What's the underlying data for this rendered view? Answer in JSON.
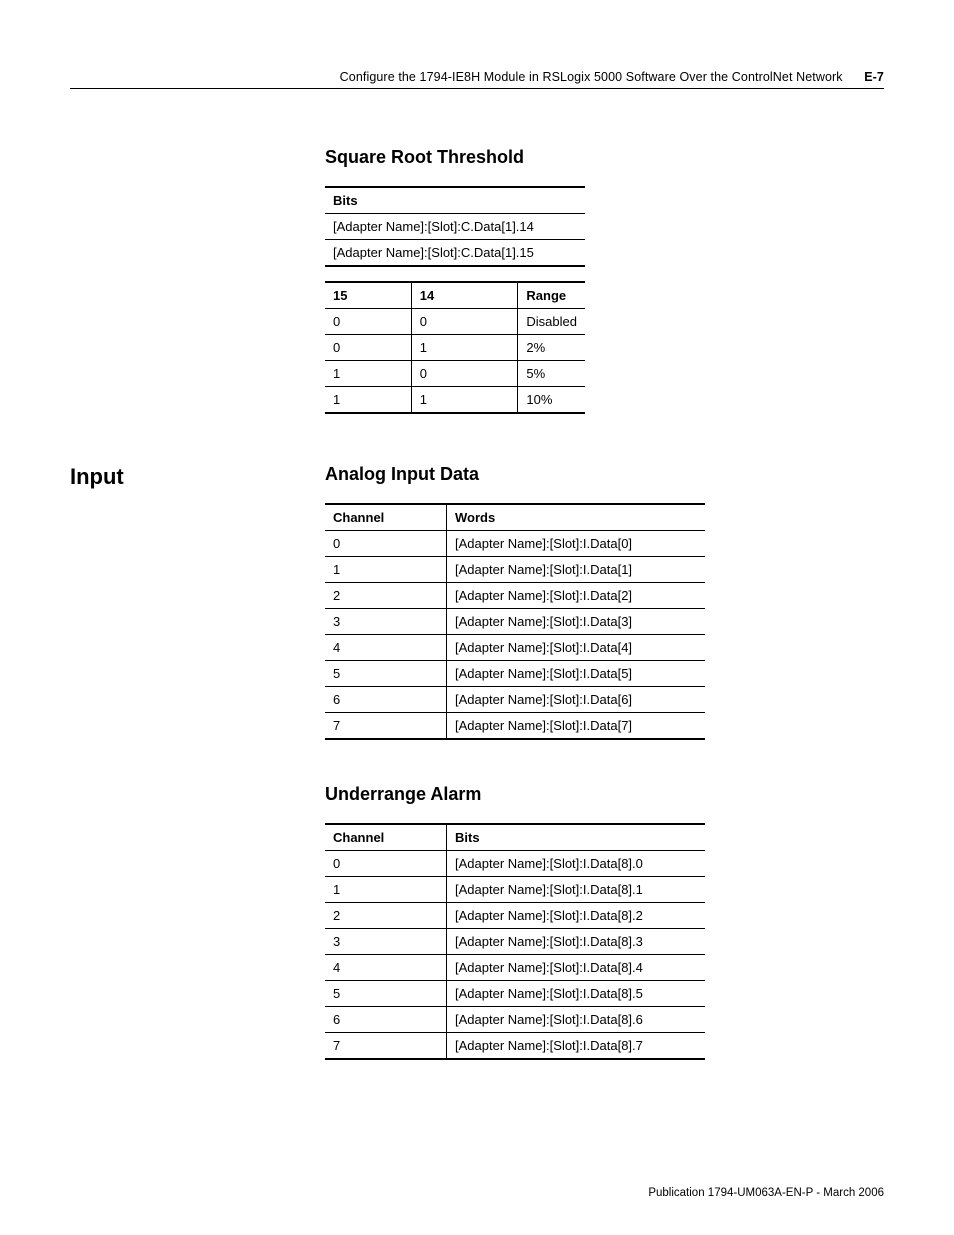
{
  "header": {
    "title": "Configure the 1794-IE8H Module in RSLogix 5000 Software Over the ControlNet Network",
    "page": "E-7"
  },
  "section1": {
    "heading": "Square Root Threshold",
    "bitsTable": {
      "header": "Bits",
      "rows": [
        "[Adapter Name]:[Slot]:C.Data[1].14",
        "[Adapter Name]:[Slot]:C.Data[1].15"
      ]
    },
    "rangeTable": {
      "headers": [
        "15",
        "14",
        "Range"
      ],
      "rows": [
        [
          "0",
          "0",
          "Disabled"
        ],
        [
          "0",
          "1",
          "2%"
        ],
        [
          "1",
          "0",
          "5%"
        ],
        [
          "1",
          "1",
          "10%"
        ]
      ]
    }
  },
  "section2": {
    "leftLabel": "Input",
    "heading": "Analog Input Data",
    "table": {
      "headers": [
        "Channel",
        "Words"
      ],
      "rows": [
        [
          "0",
          "[Adapter Name]:[Slot]:I.Data[0]"
        ],
        [
          "1",
          "[Adapter Name]:[Slot]:I.Data[1]"
        ],
        [
          "2",
          "[Adapter Name]:[Slot]:I.Data[2]"
        ],
        [
          "3",
          "[Adapter Name]:[Slot]:I.Data[3]"
        ],
        [
          "4",
          "[Adapter Name]:[Slot]:I.Data[4]"
        ],
        [
          "5",
          "[Adapter Name]:[Slot]:I.Data[5]"
        ],
        [
          "6",
          "[Adapter Name]:[Slot]:I.Data[6]"
        ],
        [
          "7",
          "[Adapter Name]:[Slot]:I.Data[7]"
        ]
      ]
    }
  },
  "section3": {
    "heading": "Underrange Alarm",
    "table": {
      "headers": [
        "Channel",
        "Bits"
      ],
      "rows": [
        [
          "0",
          "[Adapter Name]:[Slot]:I.Data[8].0"
        ],
        [
          "1",
          "[Adapter Name]:[Slot]:I.Data[8].1"
        ],
        [
          "2",
          "[Adapter Name]:[Slot]:I.Data[8].2"
        ],
        [
          "3",
          "[Adapter Name]:[Slot]:I.Data[8].3"
        ],
        [
          "4",
          "[Adapter Name]:[Slot]:I.Data[8].4"
        ],
        [
          "5",
          "[Adapter Name]:[Slot]:I.Data[8].5"
        ],
        [
          "6",
          "[Adapter Name]:[Slot]:I.Data[8].6"
        ],
        [
          "7",
          "[Adapter Name]:[Slot]:I.Data[8].7"
        ]
      ]
    }
  },
  "footer": "Publication 1794-UM063A-EN-P - March 2006"
}
